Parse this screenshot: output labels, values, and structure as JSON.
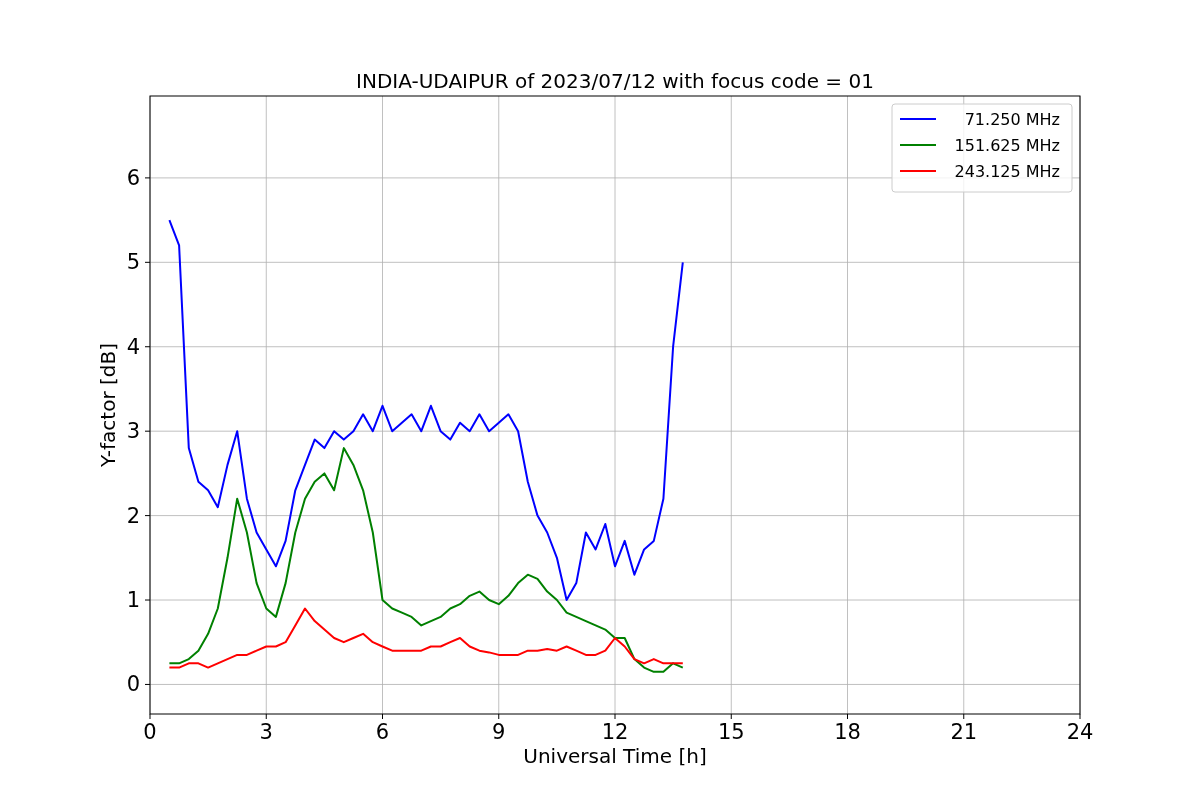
{
  "chart_data": {
    "type": "line",
    "title": "INDIA-UDAIPUR of 2023/07/12 with focus code = 01",
    "xlabel": "Universal Time [h]",
    "ylabel": "Y-factor [dB]",
    "x": [
      0.5,
      0.75,
      1.0,
      1.25,
      1.5,
      1.75,
      2.0,
      2.25,
      2.5,
      2.75,
      3.0,
      3.25,
      3.5,
      3.75,
      4.0,
      4.25,
      4.5,
      4.75,
      5.0,
      5.25,
      5.5,
      5.75,
      6.0,
      6.25,
      6.5,
      6.75,
      7.0,
      7.25,
      7.5,
      7.75,
      8.0,
      8.25,
      8.5,
      8.75,
      9.0,
      9.25,
      9.5,
      9.75,
      10.0,
      10.25,
      10.5,
      10.75,
      11.0,
      11.25,
      11.5,
      11.75,
      12.0,
      12.25,
      12.5,
      12.75,
      13.0,
      13.25,
      13.5,
      13.75
    ],
    "series": [
      {
        "name": "71.250 MHz",
        "color": "#0000ff",
        "values": [
          5.5,
          5.2,
          2.8,
          2.4,
          2.3,
          2.1,
          2.6,
          3.0,
          2.2,
          1.8,
          1.6,
          1.4,
          1.7,
          2.3,
          2.6,
          2.9,
          2.8,
          3.0,
          2.9,
          3.0,
          3.2,
          3.0,
          3.3,
          3.0,
          3.1,
          3.2,
          3.0,
          3.3,
          3.0,
          2.9,
          3.1,
          3.0,
          3.2,
          3.0,
          3.1,
          3.2,
          3.0,
          2.4,
          2.0,
          1.8,
          1.5,
          1.0,
          1.2,
          1.8,
          1.6,
          1.9,
          1.4,
          1.7,
          1.3,
          1.6,
          1.7,
          2.2,
          4.0,
          5.0
        ]
      },
      {
        "name": "151.625 MHz",
        "color": "#008000",
        "values": [
          0.25,
          0.25,
          0.3,
          0.4,
          0.6,
          0.9,
          1.5,
          2.2,
          1.8,
          1.2,
          0.9,
          0.8,
          1.2,
          1.8,
          2.2,
          2.4,
          2.5,
          2.3,
          2.8,
          2.6,
          2.3,
          1.8,
          1.0,
          0.9,
          0.85,
          0.8,
          0.7,
          0.75,
          0.8,
          0.9,
          0.95,
          1.05,
          1.1,
          1.0,
          0.95,
          1.05,
          1.2,
          1.3,
          1.25,
          1.1,
          1.0,
          0.85,
          0.8,
          0.75,
          0.7,
          0.65,
          0.55,
          0.55,
          0.3,
          0.2,
          0.15,
          0.15,
          0.25,
          0.2
        ]
      },
      {
        "name": "243.125 MHz",
        "color": "#ff0000",
        "values": [
          0.2,
          0.2,
          0.25,
          0.25,
          0.2,
          0.25,
          0.3,
          0.35,
          0.35,
          0.4,
          0.45,
          0.45,
          0.5,
          0.7,
          0.9,
          0.75,
          0.65,
          0.55,
          0.5,
          0.55,
          0.6,
          0.5,
          0.45,
          0.4,
          0.4,
          0.4,
          0.4,
          0.45,
          0.45,
          0.5,
          0.55,
          0.45,
          0.4,
          0.38,
          0.35,
          0.35,
          0.35,
          0.4,
          0.4,
          0.42,
          0.4,
          0.45,
          0.4,
          0.35,
          0.35,
          0.4,
          0.55,
          0.45,
          0.3,
          0.25,
          0.3,
          0.25,
          0.25,
          0.25
        ]
      }
    ],
    "grid": true,
    "legend": true,
    "xlim": [
      0,
      24
    ],
    "ylim": [
      -0.35,
      6.97
    ],
    "xticks": [
      0,
      3,
      6,
      9,
      12,
      15,
      18,
      21,
      24
    ],
    "yticks": [
      0,
      1,
      2,
      3,
      4,
      5,
      6
    ]
  }
}
